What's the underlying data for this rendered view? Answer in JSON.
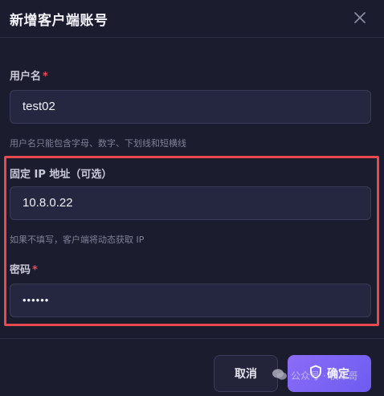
{
  "dialog": {
    "title": "新增客户端账号"
  },
  "fields": {
    "username": {
      "label": "用户名",
      "required_mark": "*",
      "value": "test02",
      "hint": "用户名只能包含字母、数字、下划线和短横线"
    },
    "fixed_ip": {
      "label": "固定 IP 地址（可选）",
      "value": "10.8.0.22",
      "hint": "如果不填写，客户端将动态获取 IP"
    },
    "password": {
      "label": "密码",
      "required_mark": "*",
      "value": "••••••"
    }
  },
  "footer": {
    "cancel_label": "取消",
    "confirm_label": "确定"
  },
  "watermark": {
    "text": "公众号 · 秩军哥"
  },
  "icons": {
    "close": "close-icon",
    "confirm": "shield-icon",
    "watermark": "wechat-icon"
  },
  "colors": {
    "background": "#1b1c2e",
    "input_bg": "#25263f",
    "required": "#ef4b55",
    "highlight_border": "#e8494f",
    "primary_button": "#7c63f4"
  }
}
